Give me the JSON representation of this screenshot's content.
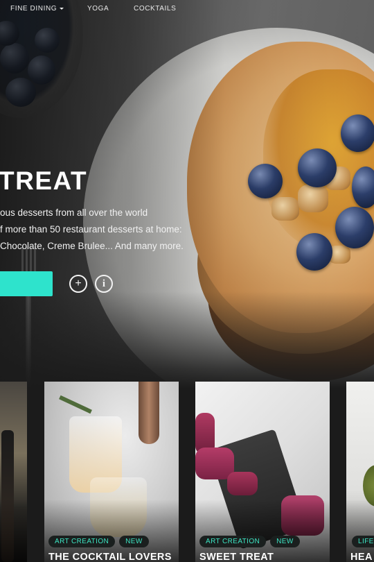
{
  "nav": {
    "items": [
      {
        "label": "FINE DINING",
        "has_dropdown": true
      },
      {
        "label": "YOGA",
        "has_dropdown": false
      },
      {
        "label": "COCKTAILS",
        "has_dropdown": false
      }
    ]
  },
  "hero": {
    "title": "TREAT",
    "lines": [
      "ous desserts from all over the world",
      "f more than 50 restaurant desserts at home:",
      "Chocolate, Creme Brulee... And many more."
    ],
    "cta_label": "/",
    "add_icon": "plus-circle-icon",
    "info_icon": "info-circle-icon",
    "add_glyph": "+",
    "info_glyph": "i"
  },
  "cards": [
    {
      "title": "",
      "tags": []
    },
    {
      "title": "THE COCKTAIL LOVERS",
      "tags": [
        "ART CREATION",
        "NEW"
      ]
    },
    {
      "title": "SWEET TREAT",
      "tags": [
        "ART CREATION",
        "NEW"
      ]
    },
    {
      "title": "HEA",
      "tags": [
        "LIFE"
      ]
    }
  ],
  "colors": {
    "accent": "#2ee3cc",
    "tag_text": "#3ee6c4",
    "tag_bg": "#1a1f1e",
    "background": "#1b1b1b"
  }
}
